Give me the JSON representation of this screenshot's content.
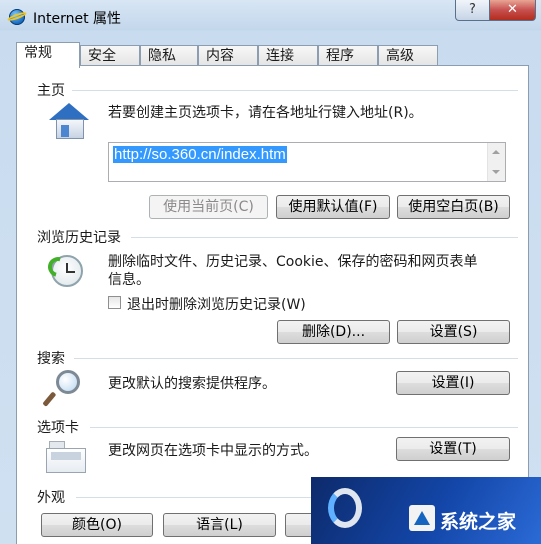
{
  "window": {
    "title": "Internet 属性",
    "help_label": "?",
    "close_label": "✕"
  },
  "tabs": [
    {
      "label": "常规",
      "active": true
    },
    {
      "label": "安全"
    },
    {
      "label": "隐私"
    },
    {
      "label": "内容"
    },
    {
      "label": "连接"
    },
    {
      "label": "程序"
    },
    {
      "label": "高级"
    }
  ],
  "home": {
    "group_label": "主页",
    "description": "若要创建主页选项卡，请在各地址行键入地址(R)。",
    "url": "http://so.360.cn/index.htm",
    "buttons": {
      "use_current": "使用当前页(C)",
      "use_default": "使用默认值(F)",
      "use_blank": "使用空白页(B)"
    }
  },
  "history": {
    "group_label": "浏览历史记录",
    "description_line1": "删除临时文件、历史记录、Cookie、保存的密码和网页表单",
    "description_line2": "信息。",
    "checkbox_label": "退出时删除浏览历史记录(W)",
    "checkbox_checked": false,
    "delete_button": "删除(D)...",
    "settings_button": "设置(S)"
  },
  "search": {
    "group_label": "搜索",
    "description": "更改默认的搜索提供程序。",
    "settings_button": "设置(I)"
  },
  "tabs_section": {
    "group_label": "选项卡",
    "description": "更改网页在选项卡中显示的方式。",
    "settings_button": "设置(T)"
  },
  "appearance": {
    "group_label": "外观",
    "colors_button": "颜色(O)",
    "languages_button": "语言(L)"
  },
  "watermark": {
    "text": "系统之家"
  },
  "colors": {
    "selection": "#3399ff",
    "close_button": "#c75050"
  }
}
